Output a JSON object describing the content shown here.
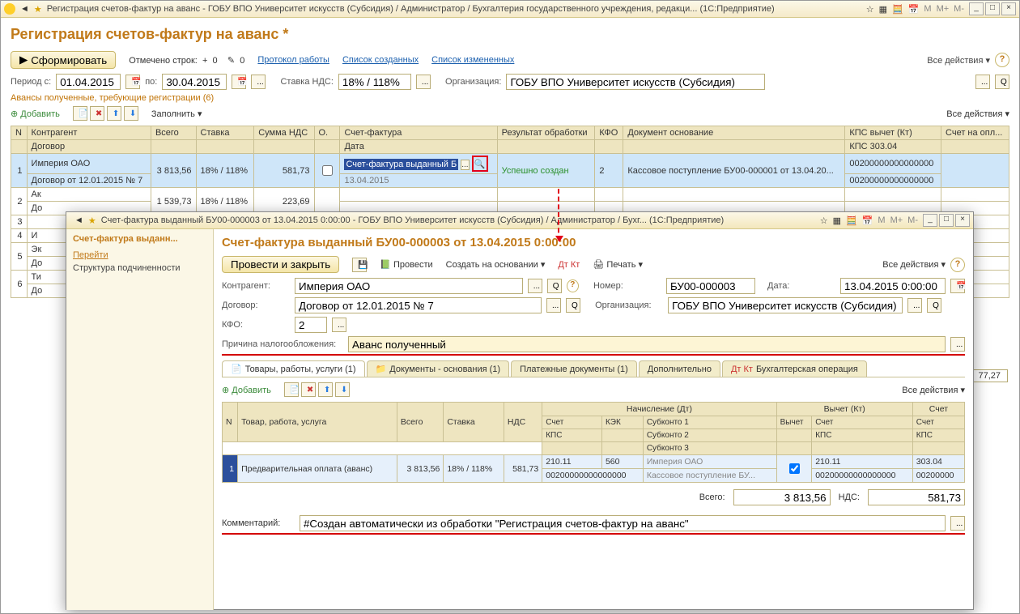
{
  "app_title": "Регистрация счетов-фактур на аванс - ГОБУ ВПО Университет искусств (Субсидия) / Администратор / Бухгалтерия государственного учреждения, редакци...  (1С:Предприятие)",
  "tb_icons": {
    "m": "M",
    "mplus": "M+",
    "mminus": "M-"
  },
  "page_title": "Регистрация счетов-фактур на аванс *",
  "main_toolbar": {
    "form_btn": "Сформировать",
    "marked_label": "Отмечено строк:",
    "marked_plus": "+",
    "marked_plus_n": "0",
    "marked_minus_ico": "✎",
    "marked_minus_n": "0",
    "protocol": "Протокол работы",
    "list_created": "Список созданных",
    "list_changed": "Список измененных",
    "all_actions": "Все действия ▾"
  },
  "filters": {
    "period_from_lbl": "Период с:",
    "period_from": "01.04.2015",
    "period_to_lbl": "по:",
    "period_to": "30.04.2015",
    "nds_lbl": "Ставка НДС:",
    "nds": "18% / 118%",
    "org_lbl": "Организация:",
    "org": "ГОБУ ВПО Университет искусств (Субсидия)"
  },
  "status_line": "Авансы полученные, требующие регистрации (6)",
  "row_toolbar": {
    "add": "Добавить",
    "fill": "Заполнить ▾",
    "all_actions": "Все действия ▾"
  },
  "table": {
    "cols": [
      "N",
      "Контрагент",
      "Всего",
      "Ставка",
      "Сумма НДС",
      "О.",
      "Счет-фактура",
      "Результат обработки",
      "КФО",
      "Документ основание",
      "КПС вычет (Кт)",
      "Счет на опл..."
    ],
    "cols2": [
      "",
      "Договор",
      "",
      "",
      "",
      "",
      "Дата",
      "",
      "",
      "",
      "КПС 303.04",
      ""
    ],
    "rows": [
      {
        "n": "1",
        "c": "Империя ОАО",
        "sum": "3 813,56",
        "rate": "18% / 118%",
        "nds": "581,73",
        "o": "",
        "sf": "Счет-фактура выданный Б",
        "date": "13.04.2015",
        "res": "Успешно создан",
        "kfo": "2",
        "doc": "Кассовое поступление БУ00-000001 от 13.04.20...",
        "kps": "00200000000000000",
        "kps2": "00200000000000000",
        "dog": "Договор от 12.01.2015 № 7"
      },
      {
        "n": "2",
        "c": "Ак",
        "dog": "До",
        "sum": "1 539,73",
        "rate": "18% / 118%",
        "nds": "223,69"
      },
      {
        "n": "3",
        "c": ""
      },
      {
        "n": "4",
        "c": "И"
      },
      {
        "n": "5",
        "c": "Эк",
        "dog": "До"
      },
      {
        "n": "6",
        "c": "Ти",
        "dog": "До"
      }
    ]
  },
  "footer_total": "77,27",
  "dialog": {
    "title": "Счет-фактура выданный БУ00-000003 от 13.04.2015 0:00:00 - ГОБУ ВПО Университет искусств (Субсидия) / Администратор / Бухг...  (1С:Предприятие)",
    "sidebar": {
      "hdr": "Счет-фактура выданн...",
      "sect": "Перейти",
      "item": "Структура подчиненности"
    },
    "heading": "Счет-фактура выданный БУ00-000003 от 13.04.2015 0:00:00",
    "actions": {
      "save_close": "Провести и закрыть",
      "post": "Провести",
      "create_base": "Создать на основании ▾",
      "print": "Печать ▾",
      "all_actions": "Все действия ▾"
    },
    "fields": {
      "contr_lbl": "Контрагент:",
      "contr": "Империя ОАО",
      "num_lbl": "Номер:",
      "num": "БУ00-000003",
      "date_lbl": "Дата:",
      "date": "13.04.2015 0:00:00",
      "dog_lbl": "Договор:",
      "dog": "Договор от 12.01.2015 № 7",
      "org_lbl": "Организация:",
      "org": "ГОБУ ВПО Университет искусств (Субсидия)",
      "kfo_lbl": "КФО:",
      "kfo": "2",
      "reason_lbl": "Причина налогообложения:",
      "reason": "Аванс полученный"
    },
    "tabs": [
      "Товары, работы, услуги (1)",
      "Документы - основания (1)",
      "Платежные документы (1)",
      "Дополнительно",
      "Бухгалтерская операция"
    ],
    "row_toolbar": {
      "add": "Добавить",
      "all_actions": "Все действия ▾"
    },
    "dtable": {
      "group": {
        "charge": "Начисление (Дт)",
        "deduct": "Вычет (Кт)",
        "acc": "Счет"
      },
      "h1": [
        "N",
        "Товар, работа, услуга",
        "Всего",
        "Ставка",
        "НДС",
        "Счет",
        "КЭК",
        "Субконто 1",
        "Вычет",
        "Счет",
        "Счет"
      ],
      "h2": [
        "",
        "",
        "",
        "",
        "",
        "КПС",
        "",
        "Субконто 2",
        "",
        "КПС",
        "КПС"
      ],
      "h3": [
        "",
        "",
        "",
        "",
        "",
        "",
        "",
        "Субконто 3",
        "",
        "",
        ""
      ],
      "row": {
        "n": "1",
        "good": "Предварительная оплата (аванс)",
        "sum": "3 813,56",
        "rate": "18% / 118%",
        "nds": "581,73",
        "acc": "210.11",
        "kek": "560",
        "sub1": "Империя ОАО",
        "kps": "00200000000000000",
        "sub2": "Кассовое поступление БУ...",
        "ded": "✓",
        "acc2": "210.11",
        "kps2": "00200000000000000",
        "acc3": "303.04",
        "kps3": "00200000"
      }
    },
    "totals": {
      "lbl_sum": "Всего:",
      "sum": "3 813,56",
      "lbl_nds": "НДС:",
      "nds": "581,73"
    },
    "comment": {
      "lbl": "Комментарий:",
      "val": "#Создан автоматически из обработки \"Регистрация счетов-фактур на аванс\""
    }
  }
}
